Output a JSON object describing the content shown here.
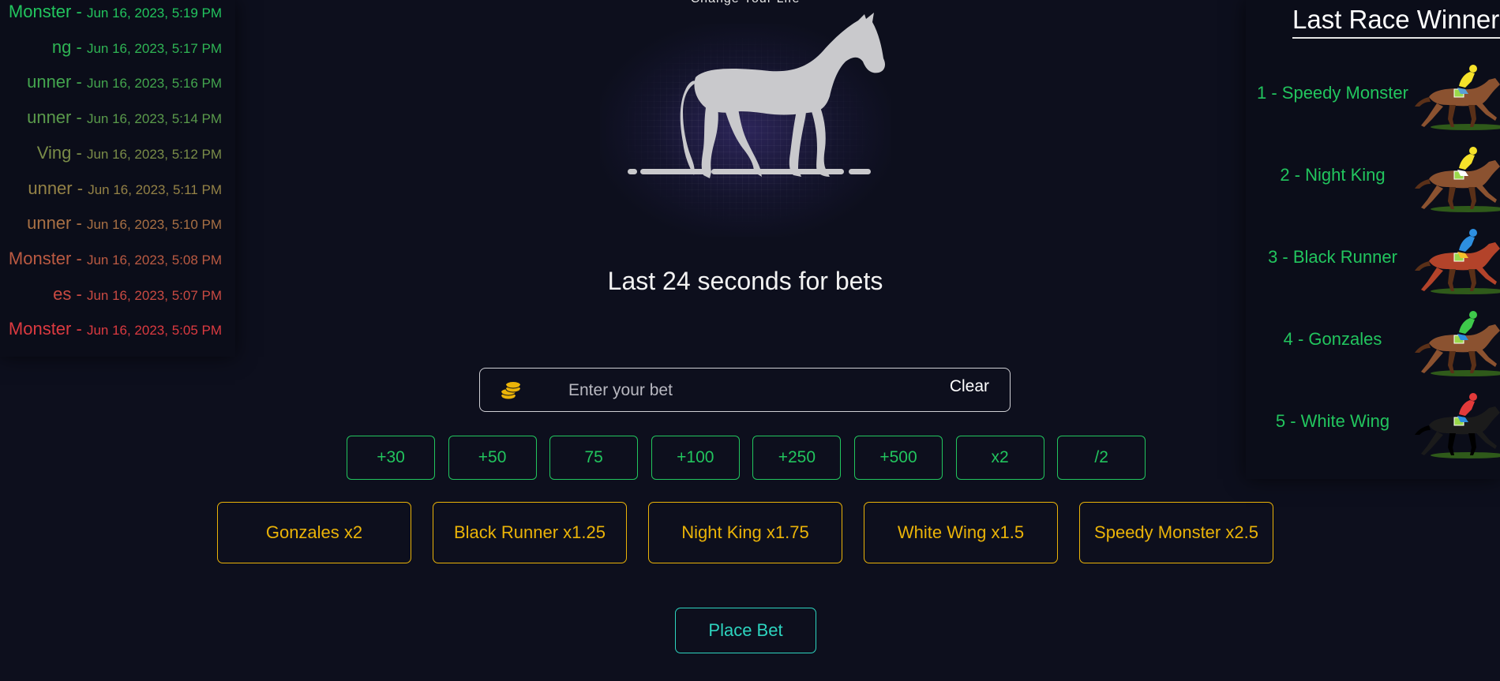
{
  "history": [
    {
      "name": "Monster",
      "date": "Jun 16, 2023, 5:19 PM",
      "color": "#22c55e"
    },
    {
      "name": "ng",
      "date": "Jun 16, 2023, 5:17 PM",
      "color": "#2fb454"
    },
    {
      "name": "unner",
      "date": "Jun 16, 2023, 5:16 PM",
      "color": "#43a54e"
    },
    {
      "name": "unner",
      "date": "Jun 16, 2023, 5:14 PM",
      "color": "#5a9a4b"
    },
    {
      "name": "Ving",
      "date": "Jun 16, 2023, 5:12 PM",
      "color": "#7a8c48"
    },
    {
      "name": "unner",
      "date": "Jun 16, 2023, 5:11 PM",
      "color": "#948246"
    },
    {
      "name": "unner",
      "date": "Jun 16, 2023, 5:10 PM",
      "color": "#a87044"
    },
    {
      "name": "Monster",
      "date": "Jun 16, 2023, 5:08 PM",
      "color": "#bb5a42"
    },
    {
      "name": "es",
      "date": "Jun 16, 2023, 5:07 PM",
      "color": "#c94a42"
    },
    {
      "name": "Monster",
      "date": "Jun 16, 2023, 5:05 PM",
      "color": "#dc3a40"
    }
  ],
  "header": {
    "tagline": "Change Your Life"
  },
  "countdown": "Last 24 seconds for bets",
  "bet": {
    "placeholder": "Enter your bet",
    "clear_label": "Clear",
    "icon": "coins-icon"
  },
  "chips": [
    "+30",
    "+50",
    "75",
    "+100",
    "+250",
    "+500",
    "x2",
    "/2"
  ],
  "horses": [
    "Gonzales x2",
    "Black Runner x1.25",
    "Night King x1.75",
    "White Wing x1.5",
    "Speedy Monster x2.5"
  ],
  "place_bet_label": "Place Bet",
  "winners": {
    "title": "Last Race Winners",
    "items": [
      {
        "label": "1 - Speedy Monster",
        "horse": "brown",
        "jockey": "#f5e12a",
        "pants": "#5aa0d6"
      },
      {
        "label": "2 - Night King",
        "horse": "brown",
        "jockey": "#f5e12a",
        "pants": "#ffffff"
      },
      {
        "label": "3 - Black Runner",
        "horse": "red",
        "jockey": "#2d8fe0",
        "pants": "#f5c02a"
      },
      {
        "label": "4 - Gonzales",
        "horse": "brown",
        "jockey": "#3ec94a",
        "pants": "#2d8fe0"
      },
      {
        "label": "5 - White Wing",
        "horse": "black",
        "jockey": "#e23a3a",
        "pants": "#2d8fe0"
      }
    ]
  },
  "colors": {
    "background": "#0d0f1d",
    "chip": "#22c55e",
    "horse_option": "#eab308",
    "place_bet": "#2dd4bf",
    "winner_text": "#22c55e"
  }
}
